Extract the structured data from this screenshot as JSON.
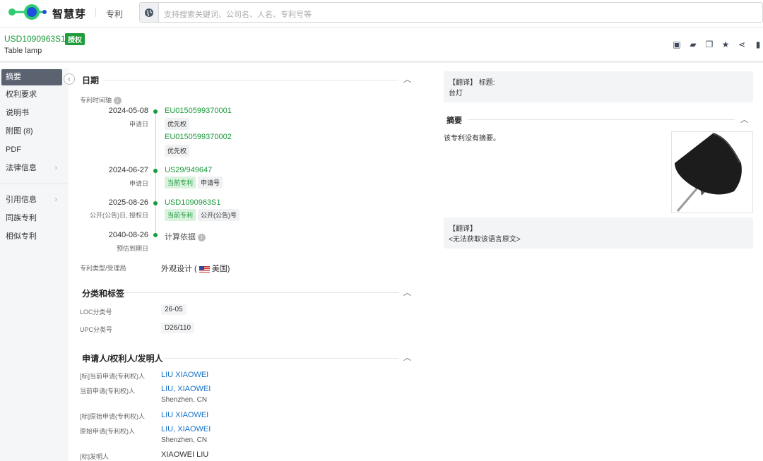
{
  "header": {
    "brand": "智慧芽",
    "nav": "专利",
    "search_placeholder": "支持搜索关键词、公司名、人名、专利号等"
  },
  "patent": {
    "id": "USD1090963S1",
    "status": "授权",
    "title": "Table lamp",
    "actions": [
      "pdf-download-icon",
      "folder-icon",
      "copy-icon",
      "star-icon",
      "share-icon"
    ]
  },
  "sidebar": {
    "items": [
      {
        "label": "摘要",
        "active": true
      },
      {
        "label": "权利要求"
      },
      {
        "label": "说明书"
      },
      {
        "label": "附图 (8)"
      },
      {
        "label": "PDF"
      },
      {
        "label": "法律信息"
      }
    ],
    "items2": [
      {
        "label": "引用信息"
      },
      {
        "label": "同族专利"
      },
      {
        "label": "相似专利"
      }
    ]
  },
  "dates": {
    "title": "日期",
    "timeline_label": "专利时间轴",
    "events": [
      {
        "date": "2024-05-08",
        "type": "申请日",
        "entries": [
          {
            "num": "EU0150599370001",
            "tags": [
              "优先权"
            ]
          },
          {
            "num": "EU0150599370002",
            "tags": [
              "优先权"
            ]
          }
        ]
      },
      {
        "date": "2024-06-27",
        "type": "申请日",
        "entries": [
          {
            "num": "US29/949647",
            "tags": [
              "当前专利",
              "申请号"
            ]
          }
        ]
      },
      {
        "date": "2025-08-26",
        "type": "公开(公告)日, 授权日",
        "entries": [
          {
            "num": "USD1090963S1",
            "tags": [
              "当前专利",
              "公开(公告)号"
            ]
          }
        ]
      },
      {
        "date": "2040-08-26",
        "type": "预估到期日",
        "basis": "计算依据"
      }
    ],
    "type_label": "专利类型/受理局",
    "type_value": "外观设计 (",
    "country": "美国)"
  },
  "classification": {
    "title": "分类和标签",
    "loc_label": "LOC分类号",
    "loc": "26-05",
    "upc_label": "UPC分类号",
    "upc": "D26/110"
  },
  "parties": {
    "title": "申请人/权利人/发明人",
    "rows": [
      {
        "label": "[标]当前申请(专利权)人",
        "name": "LIU XIAOWEI"
      },
      {
        "label": "当前申请(专利权)人",
        "name": "LIU, XIAOWEI",
        "loc": "Shenzhen, CN"
      },
      {
        "label": "[标]原始申请(专利权)人",
        "name": "LIU XIAOWEI"
      },
      {
        "label": "原始申请(专利权)人",
        "name": "LIU, XIAOWEI",
        "loc": "Shenzhen, CN"
      },
      {
        "label": "[标]发明人",
        "name": "XIAOWEI LIU"
      }
    ]
  },
  "right": {
    "trans_tag": "【翻译】",
    "title_label": "标题:",
    "title_value": "台灯",
    "abstract_title": "摘要",
    "abstract_text": "该专利没有摘要。",
    "trans2_tag": "【翻译】",
    "trans2_text": "<无法获取该语言原文>"
  },
  "colors": {
    "accent": "#1a9a3a",
    "link": "#1a73c8",
    "sidebar_active": "#5b6270"
  }
}
